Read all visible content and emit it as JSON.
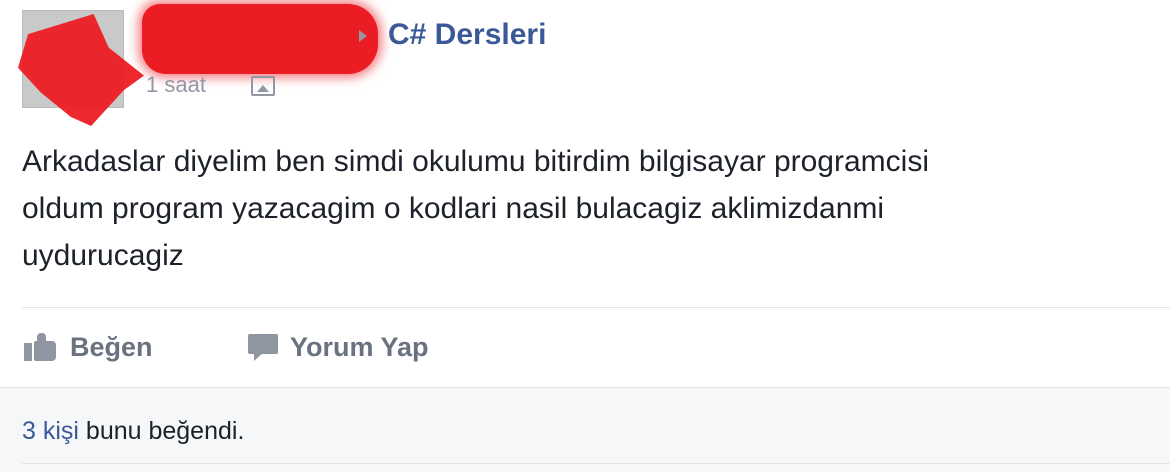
{
  "post": {
    "author_name": "",
    "group_name": "C# Dersleri",
    "timestamp": "1 saat",
    "text": "Arkadaslar diyelim ben simdi okulumu bitirdim bilgisayar programcisi\noldum program yazacagim o kodlari nasil bulacagiz aklimizdanmi\nuydurucagiz",
    "icons": {
      "arrow": "right-triangle-icon",
      "audience": "photo-icon",
      "like": "thumbs-up-icon",
      "comment": "comment-bubble-icon"
    },
    "redaction_color": "#ec1c24",
    "link_color": "#3b5998"
  },
  "actions": {
    "like_label": "Beğen",
    "comment_label": "Yorum Yap"
  },
  "likes": {
    "count_link": "3 kişi",
    "suffix": " bunu beğendi."
  }
}
